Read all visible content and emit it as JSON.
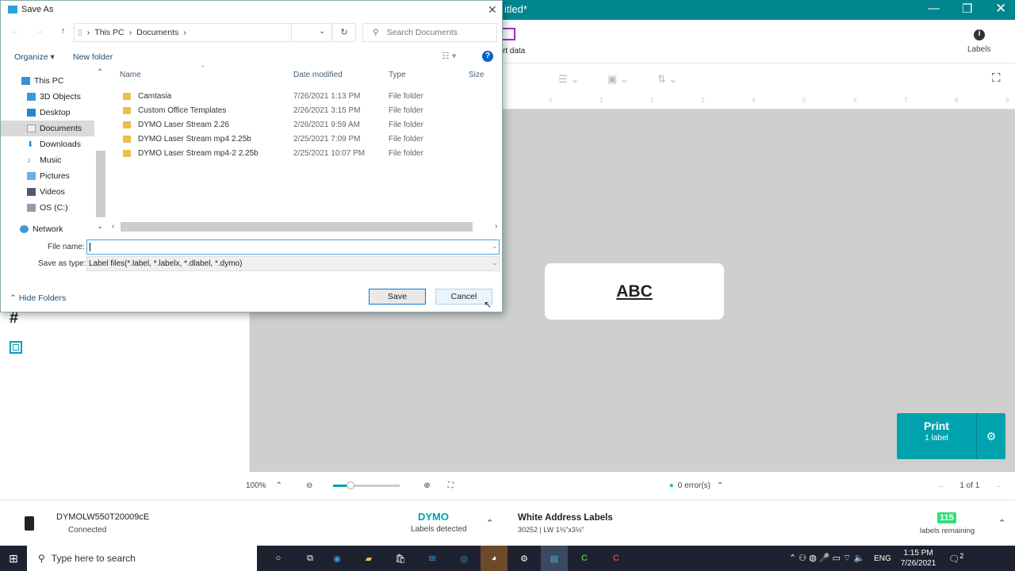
{
  "app": {
    "title_fragment": "itled*",
    "toolbar": {
      "import_data": "rt data",
      "labels": "Labels"
    },
    "label_text": "ABC",
    "print": {
      "label": "Print",
      "sub": "1 label"
    },
    "zoombar": {
      "zoom": "100%",
      "errors": "0 error(s)",
      "page": "1 of 1",
      "zoom_level": 0.25
    },
    "status": {
      "printer": "DYMOLW550T20009cE",
      "connection": "Connected",
      "brand": "DYMO",
      "brand_sub": "Labels detected",
      "label_name": "White Address Labels",
      "label_spec": "30252 | LW 1⅛\"x3½\"",
      "remaining": "115",
      "remaining_label": "labels remaining"
    },
    "ruler": [
      "0",
      "1",
      "2",
      "3",
      "4",
      "5",
      "6",
      "7",
      "8",
      "9"
    ],
    "colors": {
      "teal": "#00868f",
      "print": "#00a3ad",
      "green": "#2ecc71"
    }
  },
  "dialog": {
    "title": "Save As",
    "breadcrumb": [
      "This PC",
      "Documents"
    ],
    "search_placeholder": "Search Documents",
    "organize": "Organize",
    "new_folder": "New folder",
    "nav": [
      {
        "label": "This PC",
        "icon": "pc-icon"
      },
      {
        "label": "3D Objects",
        "icon": "cube-icon"
      },
      {
        "label": "Desktop",
        "icon": "desktop-icon"
      },
      {
        "label": "Documents",
        "icon": "documents-icon",
        "selected": true
      },
      {
        "label": "Downloads",
        "icon": "download-icon"
      },
      {
        "label": "Music",
        "icon": "music-icon"
      },
      {
        "label": "Pictures",
        "icon": "pictures-icon"
      },
      {
        "label": "Videos",
        "icon": "videos-icon"
      },
      {
        "label": "OS (C:)",
        "icon": "drive-icon"
      },
      {
        "label": "Network",
        "icon": "network-icon"
      }
    ],
    "columns": [
      "Name",
      "Date modified",
      "Type",
      "Size"
    ],
    "files": [
      {
        "name": "Camtasia",
        "date": "7/26/2021 1:13 PM",
        "type": "File folder"
      },
      {
        "name": "Custom Office Templates",
        "date": "2/26/2021 3:15 PM",
        "type": "File folder"
      },
      {
        "name": "DYMO Laser Stream 2.26",
        "date": "2/26/2021 9:59 AM",
        "type": "File folder"
      },
      {
        "name": "DYMO Laser Stream mp4 2.25b",
        "date": "2/25/2021 7:09 PM",
        "type": "File folder"
      },
      {
        "name": "DYMO Laser Stream mp4-2 2.25b",
        "date": "2/25/2021 10:07 PM",
        "type": "File folder"
      }
    ],
    "file_name_label": "File name:",
    "file_name_value": "",
    "save_type_label": "Save as type:",
    "save_type_value": "Label files(*.label, *.labelx, *.dlabel, *.dymo)",
    "hide_folders": "Hide Folders",
    "save": "Save",
    "cancel": "Cancel"
  },
  "taskbar": {
    "search_placeholder": "Type here to search",
    "time": "1:15 PM",
    "date": "7/26/2021",
    "lang": "ENG",
    "notifications": "2"
  }
}
